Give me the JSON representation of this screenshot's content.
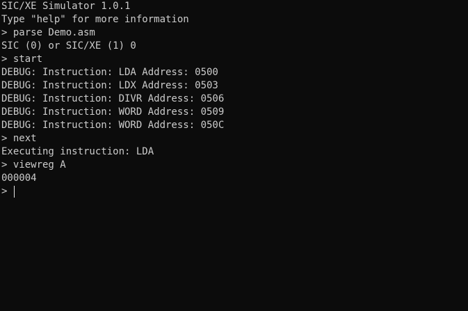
{
  "terminal": {
    "lines": [
      "SIC/XE Simulator 1.0.1",
      "Type \"help\" for more information",
      "> parse Demo.asm",
      "SIC (0) or SIC/XE (1) 0",
      "> start",
      "DEBUG: Instruction: LDA Address: 0500",
      "DEBUG: Instruction: LDX Address: 0503",
      "DEBUG: Instruction: DIVR Address: 0506",
      "DEBUG: Instruction: WORD Address: 0509",
      "DEBUG: Instruction: WORD Address: 050C",
      "> next",
      "Executing instruction: LDA",
      "> viewreg A",
      "000004"
    ],
    "prompt": "> ",
    "input_value": ""
  }
}
